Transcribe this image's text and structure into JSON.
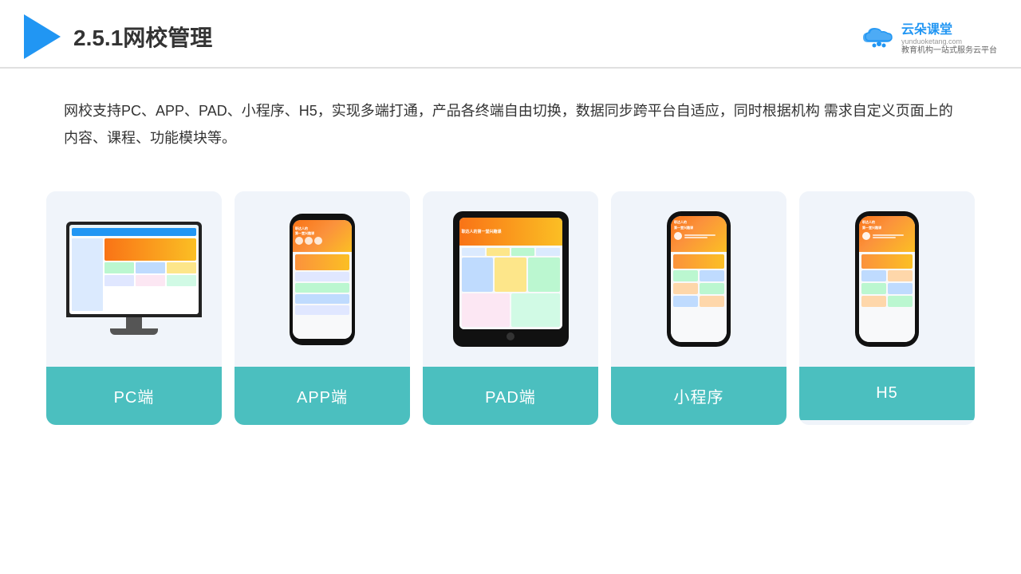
{
  "header": {
    "title": "2.5.1网校管理",
    "brand_name": "云朵课堂",
    "brand_subtitle": "教育机构一站\n式服务云平台",
    "brand_url": "yunduoketang.com"
  },
  "description": "网校支持PC、APP、PAD、小程序、H5，实现多端打通，产品各终端自由切换，数据同步跨平台自适应，同时根据机构\n需求自定义页面上的内容、课程、功能模块等。",
  "cards": [
    {
      "label": "PC端",
      "type": "pc"
    },
    {
      "label": "APP端",
      "type": "phone"
    },
    {
      "label": "PAD端",
      "type": "tablet"
    },
    {
      "label": "小程序",
      "type": "slim-phone"
    },
    {
      "label": "H5",
      "type": "slim-phone-2"
    }
  ],
  "colors": {
    "card_bg": "#f0f4fa",
    "card_label_bg": "#4BBFBF",
    "accent_blue": "#2196F3",
    "header_border": "#e0e0e0"
  }
}
